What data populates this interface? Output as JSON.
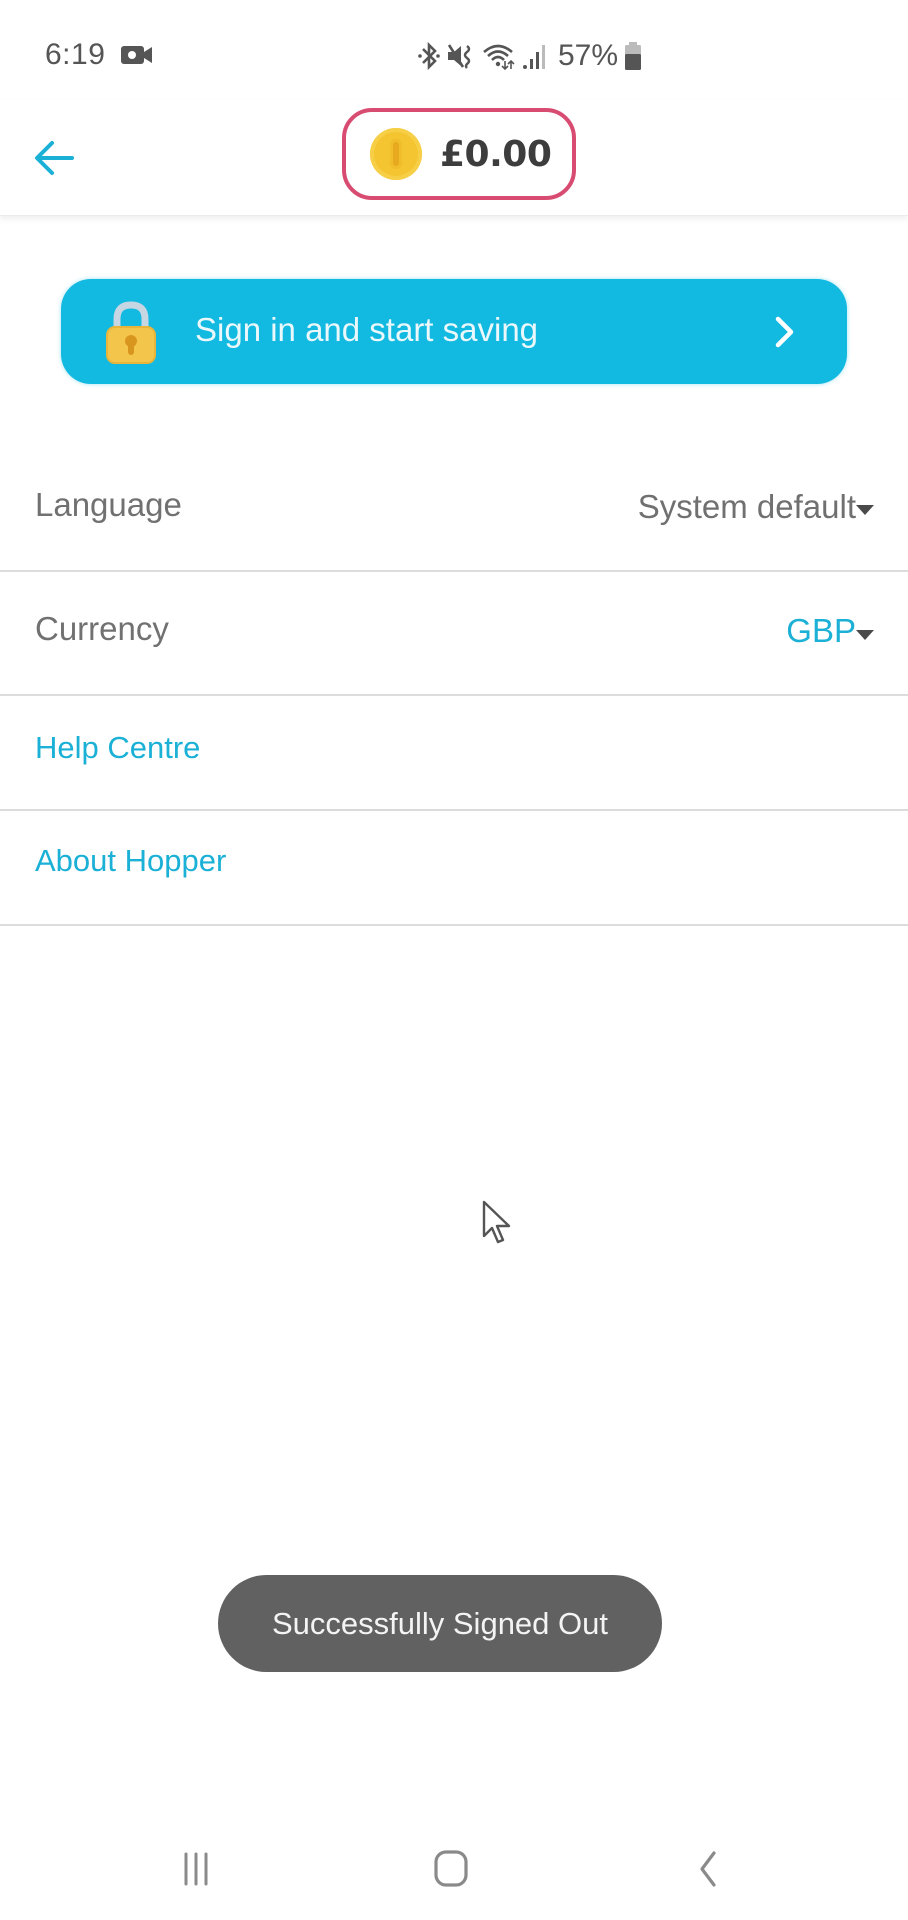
{
  "status_bar": {
    "time": "6:19",
    "battery_percent": "57%",
    "icons": [
      "video-record-icon",
      "bluetooth-icon",
      "vibrate-mute-icon",
      "wifi-icon",
      "signal-icon",
      "battery-icon"
    ]
  },
  "header": {
    "back_icon": "arrow-left-icon",
    "balance": "£0.00",
    "balance_icon": "coin-icon"
  },
  "signin_banner": {
    "label": "Sign in and start saving",
    "icon": "lock-icon",
    "chevron_icon": "chevron-right-icon"
  },
  "settings": {
    "language": {
      "label": "Language",
      "value": "System default"
    },
    "currency": {
      "label": "Currency",
      "value": "GBP"
    },
    "help": {
      "label": "Help Centre"
    },
    "about": {
      "label": "About Hopper"
    }
  },
  "toast": {
    "message": "Successfully Signed Out"
  },
  "nav_bar": {
    "recents_icon": "recents-icon",
    "home_icon": "home-icon",
    "back_icon": "back-icon"
  },
  "colors": {
    "accent": "#12b9e0",
    "link": "#1bb0d6",
    "balance_border": "#d94c72",
    "toast_bg": "#616161"
  }
}
